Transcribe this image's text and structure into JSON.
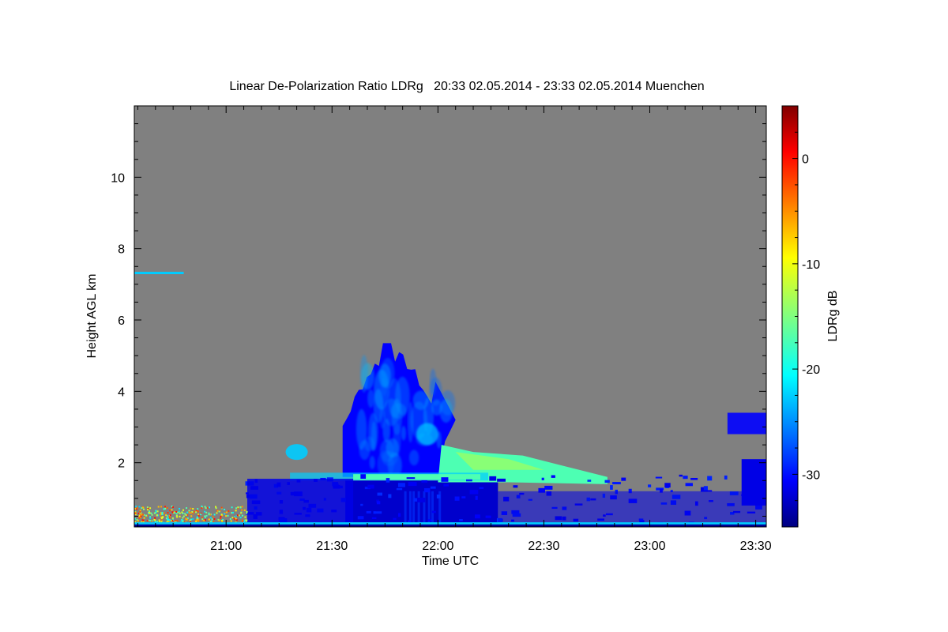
{
  "chart_data": {
    "type": "heatmap",
    "title": "Linear De-Polarization Ratio LDRg   20:33 02.05.2014 - 23:33 02.05.2014 Muenchen",
    "xlabel": "Time UTC",
    "ylabel": "Height AGL km",
    "xlim": [
      "20:34",
      "23:33"
    ],
    "ylim": [
      0.2,
      12.0
    ],
    "x_ticks": [
      "21:00",
      "21:30",
      "22:00",
      "22:30",
      "23:00",
      "23:30"
    ],
    "y_ticks": [
      "2",
      "4",
      "6",
      "8",
      "10"
    ],
    "colorbar": {
      "label": "LDRg dB",
      "range": [
        -35,
        5
      ],
      "ticks": [
        "0",
        "-10",
        "-20",
        "-30"
      ],
      "colormap": "jet"
    },
    "background_color": "#808080",
    "features": [
      {
        "kind": "convective cloud",
        "time_start": "21:47",
        "time_end": "22:04",
        "height_base_km": 1.6,
        "height_top_km": 5.4,
        "ldr_db": -30
      },
      {
        "kind": "melting layer",
        "time_start": "21:36",
        "time_end": "22:12",
        "height_km": 1.6,
        "ldr_db": -17
      },
      {
        "kind": "anvil / stratiform tail",
        "time_start": "22:04",
        "time_end": "22:48",
        "height_base_km": 1.4,
        "height_top_km": 2.2,
        "ldr_db": -17
      },
      {
        "kind": "cirrus",
        "time_start": "20:34",
        "time_end": "20:48",
        "height_km": 7.3,
        "ldr_db": -22
      },
      {
        "kind": "boundary layer",
        "time_start": "20:34",
        "time_end": "21:06",
        "height_base_km": 0.2,
        "height_top_km": 0.8,
        "ldr_db": -12
      },
      {
        "kind": "rain below melting layer",
        "time_start": "21:36",
        "time_end": "22:17",
        "height_base_km": 0.2,
        "height_top_km": 1.5,
        "ldr_db": -32
      },
      {
        "kind": "low cloud",
        "time_start": "23:22",
        "time_end": "23:33",
        "height_base_km": 2.8,
        "height_top_km": 3.4,
        "ldr_db": -30
      }
    ]
  }
}
